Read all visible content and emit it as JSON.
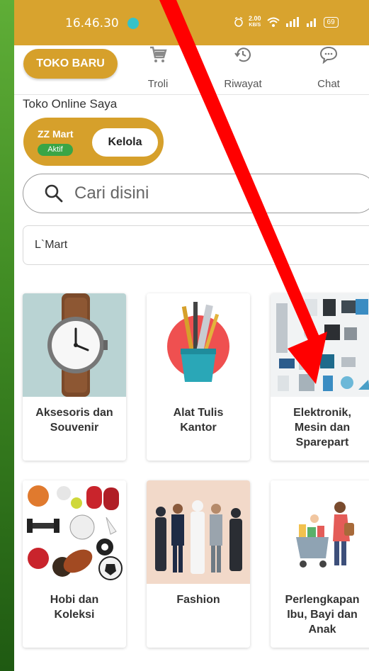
{
  "statusbar": {
    "time": "16.46.30",
    "speed_value": "2.00",
    "speed_unit": "KB/S",
    "battery": "69"
  },
  "header": {
    "new_store_label": "TOKO BARU",
    "nav": [
      {
        "label": "Troli",
        "icon": "cart-icon"
      },
      {
        "label": "Riwayat",
        "icon": "history-icon"
      },
      {
        "label": "Chat",
        "icon": "chat-icon"
      }
    ]
  },
  "store_section": {
    "label": "Toko Online Saya",
    "store_name": "ZZ Mart",
    "status": "Aktif",
    "manage_label": "Kelola"
  },
  "search": {
    "placeholder": "Cari disini"
  },
  "location": {
    "value": "L`Mart"
  },
  "categories": [
    {
      "line1": "Aksesoris dan",
      "line2": "Souvenir",
      "line3": "",
      "icon": "watch-image"
    },
    {
      "line1": "Alat Tulis",
      "line2": "Kantor",
      "line3": "",
      "icon": "stationery-image"
    },
    {
      "line1": "Elektronik,",
      "line2": "Mesin dan",
      "line3": "Sparepart",
      "icon": "electronics-image"
    },
    {
      "line1": "Hobi dan",
      "line2": "Koleksi",
      "line3": "",
      "icon": "sports-image"
    },
    {
      "line1": "Fashion",
      "line2": "",
      "line3": "",
      "icon": "fashion-image"
    },
    {
      "line1": "Perlengkapan",
      "line2": "Ibu, Bayi dan",
      "line3": "Anak",
      "icon": "mother-baby-image"
    }
  ],
  "colors": {
    "accent": "#d6a02b",
    "statusbar": "#d8a32e",
    "badge": "#3aa546",
    "annotation_arrow": "#ff0000"
  }
}
